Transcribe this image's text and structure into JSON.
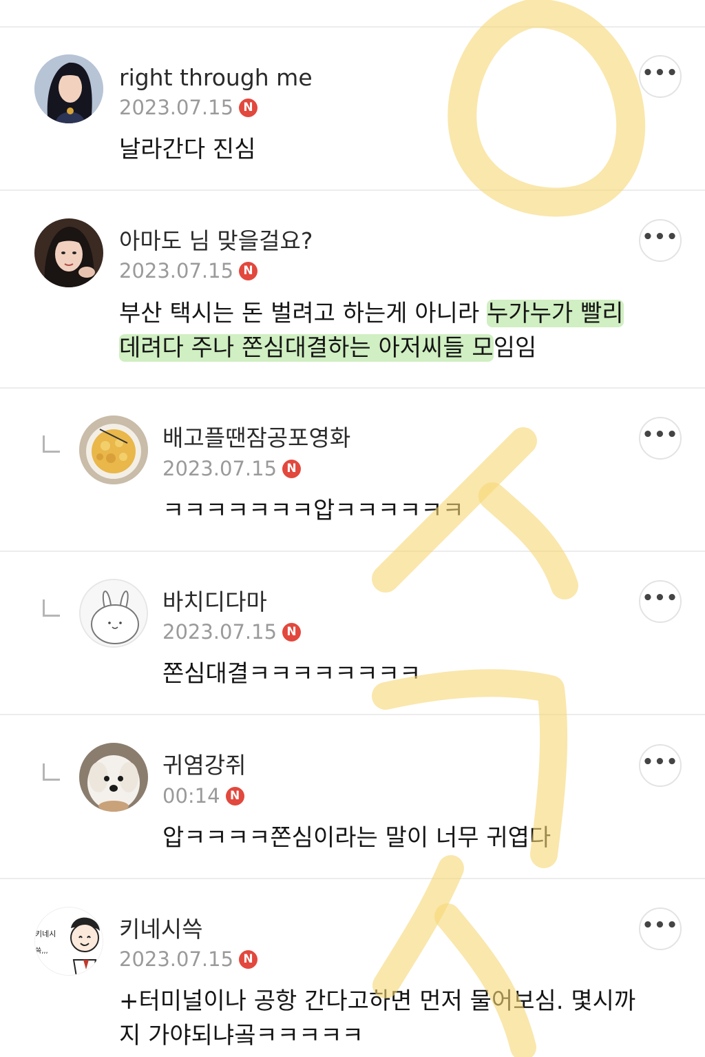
{
  "more_label": "•••",
  "new_badge": "N",
  "comments": [
    {
      "author": "right through me",
      "date": "2023.07.15",
      "lines": [
        "날라간다 진심"
      ]
    },
    {
      "author": "아마도 님 맞을걸요?",
      "date": "2023.07.15",
      "line1_plain": "부산 택시는 돈 벌려고 하는게 아니라 ",
      "line1_highlight": "누가누가 빨리",
      "line2_highlight": "데려다 주나 쫀심대결하는 아저씨들 모",
      "line2_plain": "임임"
    },
    {
      "author": "배고플땐잠공포영화",
      "date": "2023.07.15",
      "lines": [
        "ㅋㅋㅋㅋㅋㅋㅋ압ㅋㅋㅋㅋㅋㅋ"
      ]
    },
    {
      "author": "바치디다마",
      "date": "2023.07.15",
      "lines": [
        "쫀심대결ㅋㅋㅋㅋㅋㅋㅋㅋ"
      ]
    },
    {
      "author": "귀염강쥐",
      "date": "00:14",
      "lines": [
        "압ㅋㅋㅋㅋ쫀심이라는 말이 너무 귀엽다"
      ]
    },
    {
      "author": "키네시쓱",
      "date": "2023.07.15",
      "avatar_text": [
        "키네시",
        "쓱,,,"
      ],
      "lines": [
        "+터미널이나 공항 간다고하면 먼저 물어보심. 몇시까",
        "지 가야되냐곸ㅋㅋㅋㅋㅋ"
      ]
    }
  ],
  "colors": {
    "badge": "#e2483d",
    "highlighter": "#96dc78",
    "overlay_marker": "#f7d774"
  }
}
